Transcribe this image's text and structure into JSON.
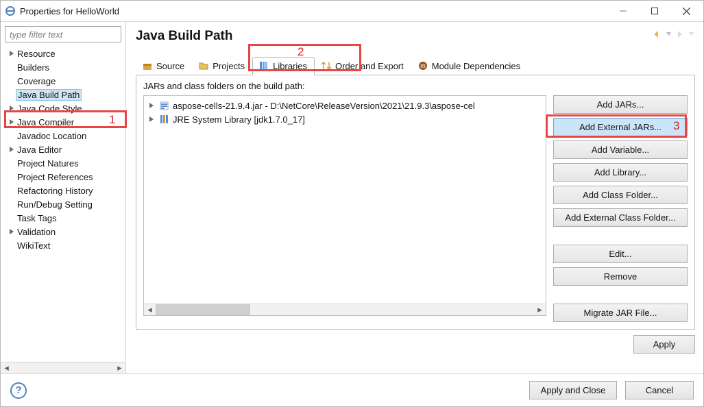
{
  "window": {
    "title": "Properties for HelloWorld"
  },
  "filter_placeholder": "type filter text",
  "sidebar": {
    "items": [
      {
        "label": "Resource",
        "expandable": true
      },
      {
        "label": "Builders",
        "expandable": false
      },
      {
        "label": "Coverage",
        "expandable": false
      },
      {
        "label": "Java Build Path",
        "expandable": false,
        "selected": true
      },
      {
        "label": "Java Code Style",
        "expandable": true
      },
      {
        "label": "Java Compiler",
        "expandable": true
      },
      {
        "label": "Javadoc Location",
        "expandable": false
      },
      {
        "label": "Java Editor",
        "expandable": true
      },
      {
        "label": "Project Natures",
        "expandable": false
      },
      {
        "label": "Project References",
        "expandable": false
      },
      {
        "label": "Refactoring History",
        "expandable": false
      },
      {
        "label": "Run/Debug Setting",
        "expandable": false
      },
      {
        "label": "Task Tags",
        "expandable": false
      },
      {
        "label": "Validation",
        "expandable": true
      },
      {
        "label": "WikiText",
        "expandable": false
      }
    ]
  },
  "page": {
    "title": "Java Build Path"
  },
  "tabs": [
    {
      "label": "Source",
      "icon": "package-icon"
    },
    {
      "label": "Projects",
      "icon": "folder-icon"
    },
    {
      "label": "Libraries",
      "icon": "library-icon",
      "active": true
    },
    {
      "label": "Order and Export",
      "icon": "order-icon"
    },
    {
      "label": "Module Dependencies",
      "icon": "module-icon"
    }
  ],
  "panel_label": "JARs and class folders on the build path:",
  "classpath": [
    {
      "label": "aspose-cells-21.9.4.jar - D:\\NetCore\\ReleaseVersion\\2021\\21.9.3\\aspose-cel",
      "icon": "jar-icon"
    },
    {
      "label": "JRE System Library [jdk1.7.0_17]",
      "icon": "jre-icon"
    }
  ],
  "buttons": {
    "add_jars": "Add JARs...",
    "add_ext_jars": "Add External JARs...",
    "add_variable": "Add Variable...",
    "add_library": "Add Library...",
    "add_class_folder": "Add Class Folder...",
    "add_ext_class_folder": "Add External Class Folder...",
    "edit": "Edit...",
    "remove": "Remove",
    "migrate": "Migrate JAR File..."
  },
  "apply": "Apply",
  "footer": {
    "apply_close": "Apply and Close",
    "cancel": "Cancel"
  },
  "annotations": {
    "n1": "1",
    "n2": "2",
    "n3": "3"
  }
}
